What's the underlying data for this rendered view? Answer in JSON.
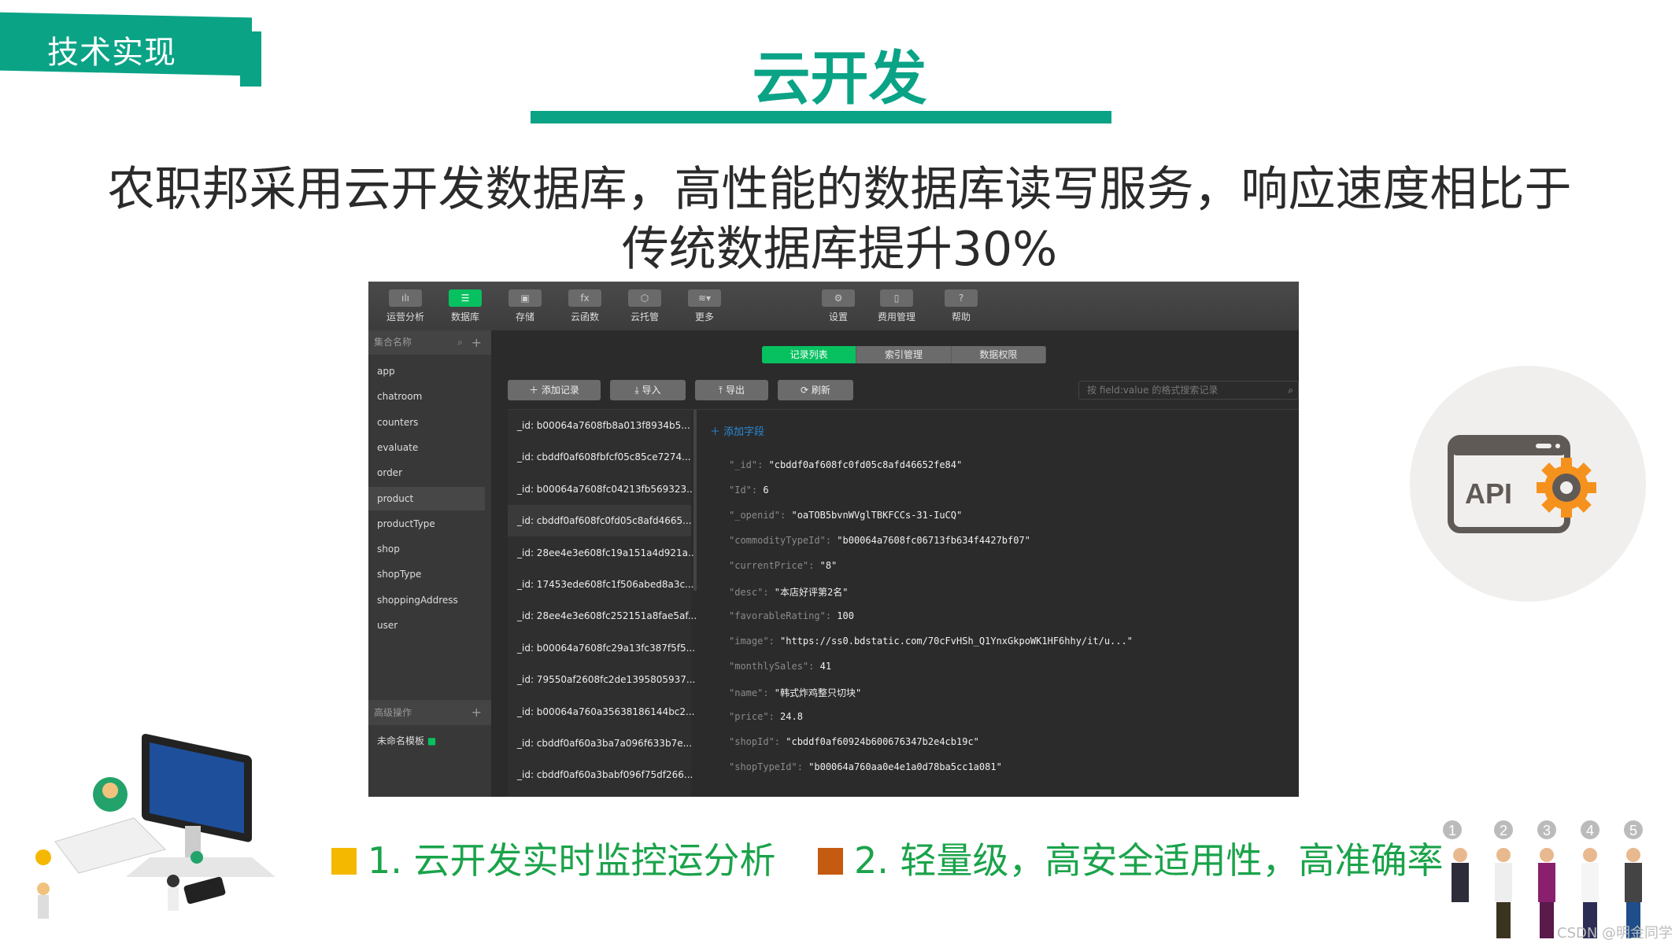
{
  "slide": {
    "section_tag": "技术实现",
    "title": "云开发",
    "subtitle_line1": "农职邦采用云开发数据库，高性能的数据库读写服务，响应速度相比于",
    "subtitle_line2": "传统数据库提升30%",
    "accent_color": "#0aa386",
    "bullets": [
      {
        "number": "1.",
        "text": "云开发实时监控运分析",
        "square_color": "#f5b800"
      },
      {
        "number": "2.",
        "text": "轻量级，高安全适用性，高准确率",
        "square_color": "#c55a11"
      }
    ],
    "api_icon_label": "API",
    "people_numbers": [
      "1",
      "2",
      "3",
      "4",
      "5"
    ],
    "watermark": "CSDN @明金同学"
  },
  "console": {
    "toolbar_left": [
      {
        "label": "运营分析",
        "icon": "bar-chart-icon"
      },
      {
        "label": "数据库",
        "icon": "database-icon",
        "active": true
      },
      {
        "label": "存储",
        "icon": "save-icon"
      },
      {
        "label": "云函数",
        "icon": "function-icon"
      },
      {
        "label": "云托管",
        "icon": "box-icon"
      },
      {
        "label": "更多",
        "icon": "layers-icon"
      }
    ],
    "toolbar_right": [
      {
        "label": "设置",
        "icon": "gear-icon"
      },
      {
        "label": "费用管理",
        "icon": "billing-icon"
      },
      {
        "label": "帮助",
        "icon": "help-icon"
      }
    ],
    "sidebar": {
      "header": "集合名称",
      "collections": [
        "app",
        "chatroom",
        "counters",
        "evaluate",
        "order",
        "product",
        "productType",
        "shop",
        "shopType",
        "shoppingAddress",
        "user"
      ],
      "selected": "product",
      "advanced": "高级操作",
      "template": "未命名模板"
    },
    "tabs": [
      {
        "label": "记录列表",
        "active": true
      },
      {
        "label": "索引管理"
      },
      {
        "label": "数据权限"
      }
    ],
    "actions": {
      "add": "添加记录",
      "import": "导入",
      "export": "导出",
      "refresh": "刷新"
    },
    "search_placeholder": "按 field:value 的格式搜索记录",
    "records": [
      "_id: b00064a7608fb8a013f8934b5...",
      "_id: cbddf0af608fbfcf05c85ce7274...",
      "_id: b00064a7608fc04213fb569323...",
      "_id: cbddf0af608fc0fd05c8afd4665...",
      "_id: 28ee4e3e608fc19a151a4d921a...",
      "_id: 17453ede608fc1f506abed8a3c...",
      "_id: 28ee4e3e608fc252151a8fae5af...",
      "_id: b00064a7608fc29a13fc387f5f5...",
      "_id: 79550af2608fc2de1395805937...",
      "_id: b00064a760a35638186144bc2...",
      "_id: cbddf0af60a3ba7a096f633b7e...",
      "_id: cbddf0af60a3babf096f75df266..."
    ],
    "selected_record": 3,
    "add_field": "添加字段",
    "fields": [
      {
        "key": "\"_id\": ",
        "value": "\"cbddf0af608fc0fd05c8afd46652fe84\""
      },
      {
        "key": "\"Id\": ",
        "value": "6"
      },
      {
        "key": "\"_openid\": ",
        "value": "\"oaTOB5bvnWVglTBKFCCs-31-IuCQ\""
      },
      {
        "key": "\"commodityTypeId\": ",
        "value": "\"b00064a7608fc06713fb634f4427bf07\""
      },
      {
        "key": "\"currentPrice\": ",
        "value": "\"8\""
      },
      {
        "key": "\"desc\": ",
        "value": "\"本店好评第2名\""
      },
      {
        "key": "\"favorableRating\": ",
        "value": "100"
      },
      {
        "key": "\"image\": ",
        "value": "\"https://ss0.bdstatic.com/70cFvHSh_Q1YnxGkpoWK1HF6hhy/it/u...\""
      },
      {
        "key": "\"monthlySales\": ",
        "value": "41"
      },
      {
        "key": "\"name\": ",
        "value": "\"韩式炸鸡整只切块\""
      },
      {
        "key": "\"price\": ",
        "value": "24.8"
      },
      {
        "key": "\"shopId\": ",
        "value": "\"cbddf0af60924b600676347b2e4cb19c\""
      },
      {
        "key": "\"shopTypeId\": ",
        "value": "\"b00064a760aa0e4e1a0d78ba5cc1a081\""
      }
    ]
  }
}
